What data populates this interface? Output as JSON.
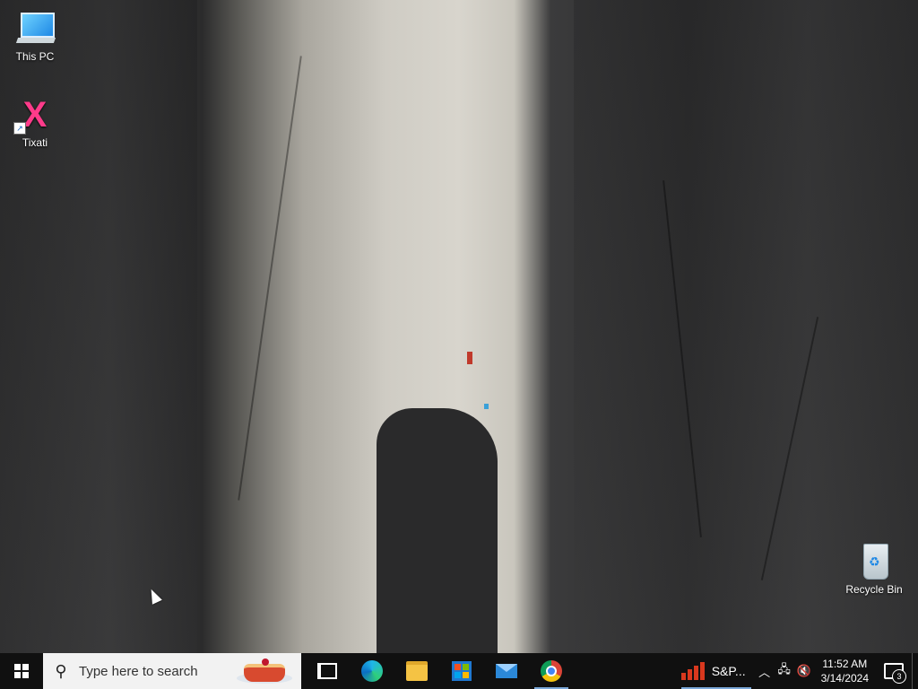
{
  "desktop": {
    "icons": [
      {
        "label": "This PC",
        "icon": "computer-icon"
      },
      {
        "label": "Tixati",
        "icon": "tixati-icon"
      },
      {
        "label": "Recycle Bin",
        "icon": "recycle-bin-icon"
      }
    ]
  },
  "taskbar": {
    "search_placeholder": "Type here to search",
    "pinned": [
      "task-view-icon",
      "edge-icon",
      "file-explorer-icon",
      "store-icon",
      "mail-icon",
      "chrome-icon"
    ],
    "running_app_label": "S&P...",
    "tray": {
      "time": "11:52 AM",
      "date": "3/14/2024",
      "notification_count": "3"
    }
  }
}
